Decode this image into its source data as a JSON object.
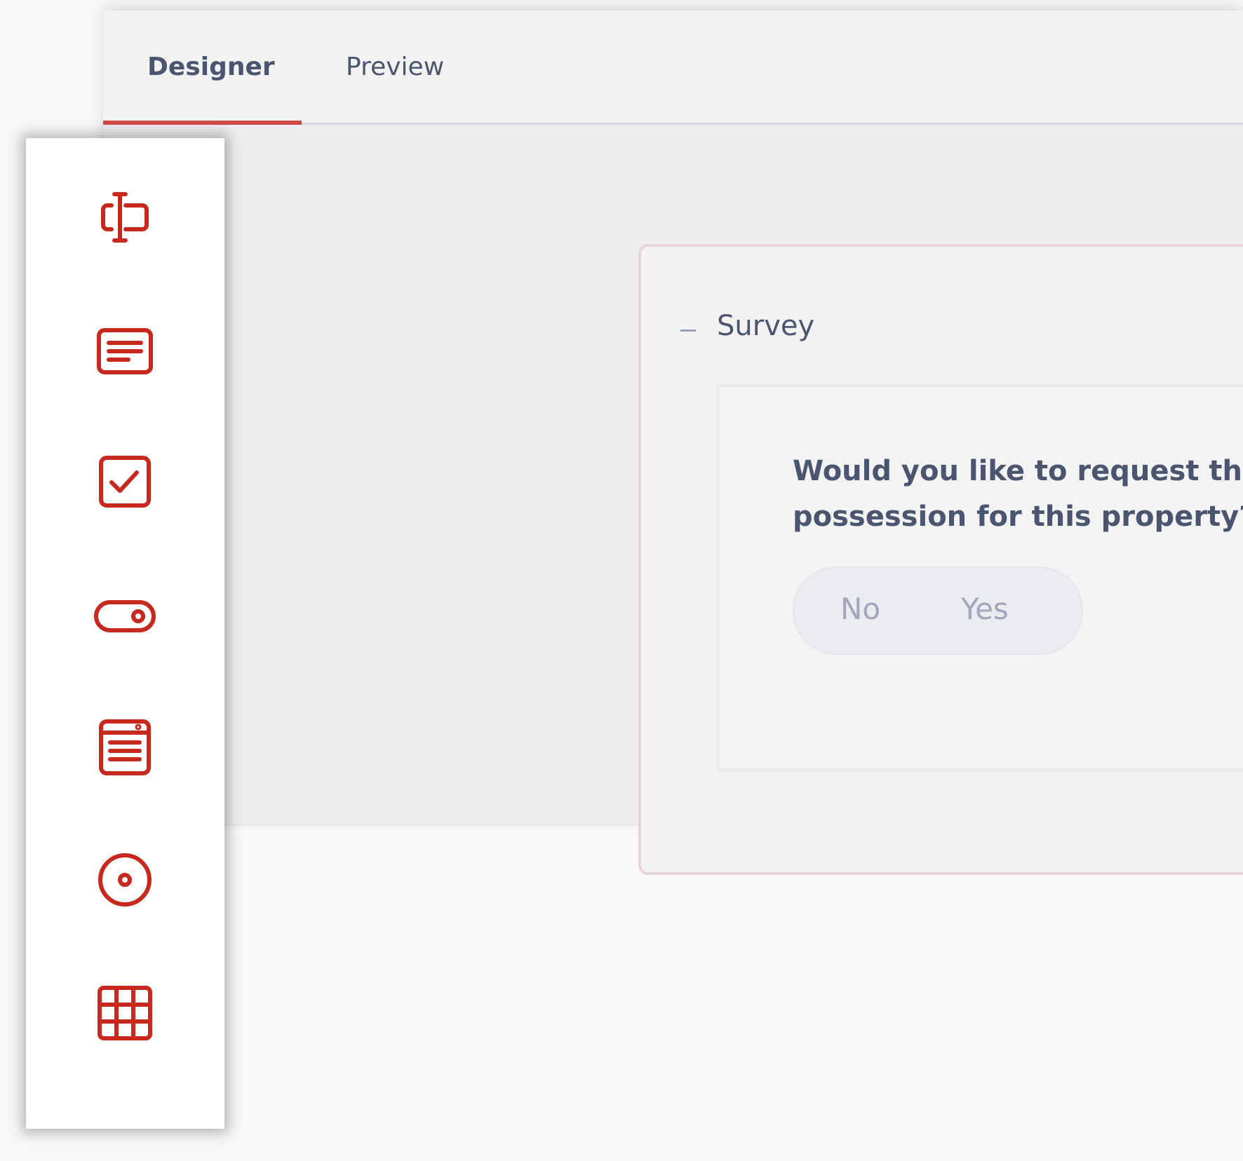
{
  "tabs": [
    {
      "label": "Designer",
      "active": true
    },
    {
      "label": "Preview",
      "active": false
    }
  ],
  "accent_color": "#c8281e",
  "toolbox": [
    "text-input-icon",
    "comment-icon",
    "checkbox-icon",
    "boolean-toggle-icon",
    "dropdown-icon",
    "radio-group-icon",
    "matrix-icon"
  ],
  "survey": {
    "title": "Survey",
    "question": {
      "line1": "Would you like to request that",
      "line2": "possession for this property?"
    },
    "options": {
      "no": "No",
      "yes": "Yes"
    }
  }
}
